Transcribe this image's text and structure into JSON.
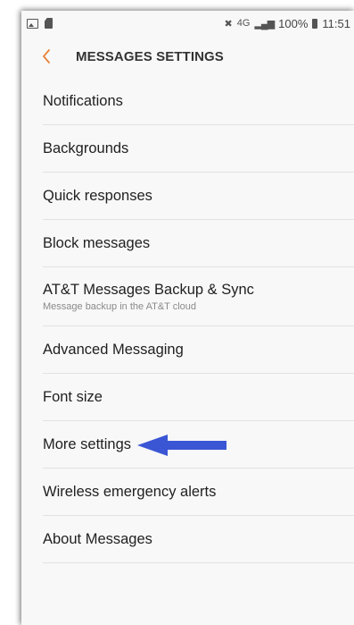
{
  "status_bar": {
    "left_icons": [
      "image-icon",
      "sd-card-icon"
    ],
    "right_icons": [
      "mute-icon",
      "network-icon",
      "signal-icon"
    ],
    "network_label": "4G",
    "battery": "100%",
    "time": "11:51"
  },
  "header": {
    "title": "MESSAGES SETTINGS",
    "back_icon": "chevron-left-icon",
    "accent_color": "#e8823a"
  },
  "settings": {
    "items": [
      {
        "label": "Notifications"
      },
      {
        "label": "Backgrounds"
      },
      {
        "label": "Quick responses"
      },
      {
        "label": "Block messages"
      },
      {
        "label": "AT&T Messages Backup & Sync",
        "subtitle": "Message backup in the AT&T cloud"
      },
      {
        "label": "Advanced Messaging"
      },
      {
        "label": "Font size"
      },
      {
        "label": "More settings"
      },
      {
        "label": "Wireless emergency alerts"
      },
      {
        "label": "About Messages"
      }
    ]
  },
  "annotation": {
    "type": "arrow-pointing-left",
    "target": "More settings",
    "color": "#3a56d4"
  }
}
